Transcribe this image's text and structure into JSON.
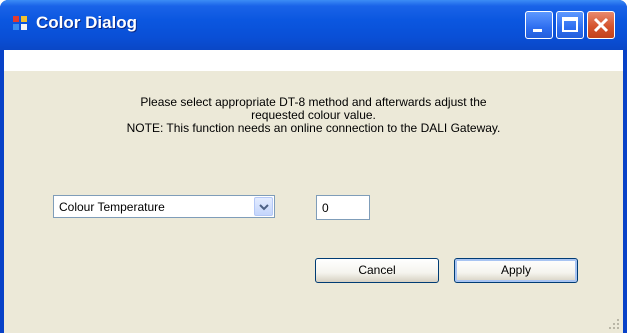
{
  "window": {
    "title": "Color Dialog"
  },
  "titlebar_buttons": {
    "minimize": "minimize-icon",
    "maximize": "maximize-icon",
    "close": "close-icon"
  },
  "message": {
    "line1": "Please select appropriate DT-8 method and afterwards adjust the",
    "line2": "requested colour value.",
    "line3": "NOTE: This function needs an online connection to the DALI Gateway."
  },
  "method_select": {
    "selected": "Colour Temperature"
  },
  "value_input": {
    "value": "0"
  },
  "buttons": {
    "cancel": "Cancel",
    "apply": "Apply"
  },
  "colors": {
    "titlebar": "#0a4fd6",
    "client_background": "#ece9d8",
    "close_button": "#d5542e"
  }
}
